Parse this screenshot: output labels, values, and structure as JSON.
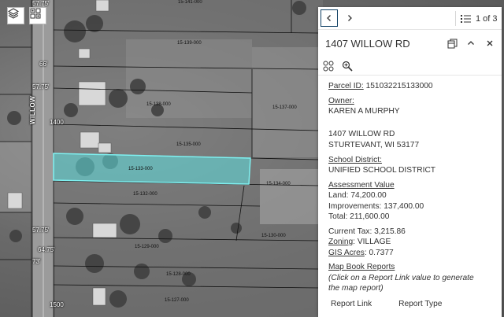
{
  "map": {
    "street_label": "WILLOW",
    "dimensions": [
      {
        "id": "d1",
        "text": "57.75'"
      },
      {
        "id": "d2",
        "text": "66'"
      },
      {
        "id": "d3",
        "text": "57.75'"
      },
      {
        "id": "d4",
        "text": "1400"
      },
      {
        "id": "d5",
        "text": "57.75'"
      },
      {
        "id": "d6",
        "text": "64.75'"
      },
      {
        "id": "d7",
        "text": "73'"
      },
      {
        "id": "d8",
        "text": "1500"
      }
    ],
    "parcels": [
      {
        "id": "p1",
        "text": "15-141-000"
      },
      {
        "id": "p2",
        "text": "15-139-000"
      },
      {
        "id": "p3",
        "text": "15-138-000"
      },
      {
        "id": "p4",
        "text": "15-137-000"
      },
      {
        "id": "p5",
        "text": "15-135-000"
      },
      {
        "id": "p6",
        "text": "15-133-000"
      },
      {
        "id": "p7",
        "text": "15-134-000"
      },
      {
        "id": "p8",
        "text": "15-132-000"
      },
      {
        "id": "p9",
        "text": "15-130-000"
      },
      {
        "id": "p10",
        "text": "15-129-000"
      },
      {
        "id": "p11",
        "text": "15-128-000"
      },
      {
        "id": "p12",
        "text": "15-127-000"
      }
    ],
    "highlight_color": "#5fe0e0"
  },
  "popup": {
    "pager": "1 of 3",
    "title": "1407 WILLOW RD",
    "parcel_id_label": "Parcel ID:",
    "parcel_id": "151032215133000",
    "owner_label": "Owner:",
    "owner": "KAREN A MURPHY",
    "address_line1": "1407 WILLOW RD",
    "address_line2": "STURTEVANT, WI  53177",
    "school_label": "School District:",
    "school": "UNIFIED SCHOOL DISTRICT",
    "assessment_label": "Assessment Value",
    "land": "Land: 74,200.00",
    "improvements": "Improvements: 137,400.00",
    "total": "Total: 211,600.00",
    "current_tax": "Current Tax: 3,215.86",
    "zoning_label": "Zoning",
    "zoning_value": ": VILLAGE",
    "gis_label": "GIS Acres",
    "gis_value": ": 0.7377",
    "mapbook_label": "Map Book Reports",
    "mapbook_note": "(Click on a Report Link value to generate the map report)",
    "col_report_link": "Report Link",
    "col_report_type": "Report Type"
  },
  "colors": {
    "accent": "#0f3f63",
    "text": "#323232"
  }
}
